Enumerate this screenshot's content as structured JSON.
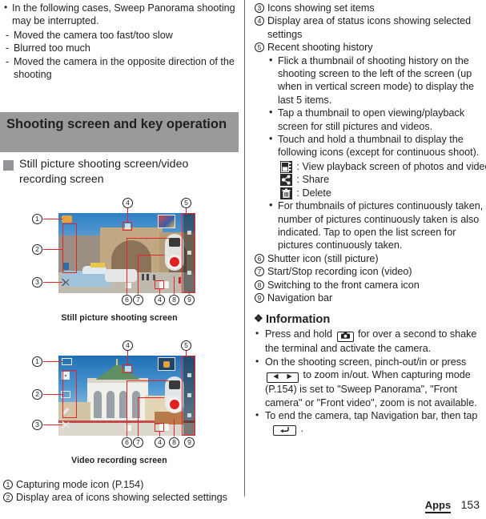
{
  "left": {
    "intro_bullet": "In the following cases, Sweep Panorama shooting may be interrupted.",
    "intro_subs": [
      "Moved the camera too fast/too slow",
      "Blurred too much",
      "Moved the camera in the opposite direction of the shooting"
    ],
    "section_heading": "Shooting screen and key operation",
    "subheading": "Still picture shooting screen/video recording screen",
    "figure1_caption": "Still picture shooting screen",
    "figure2_caption": "Video recording screen",
    "figure1_callouts": [
      "1",
      "2",
      "3",
      "4",
      "5",
      "6",
      "7",
      "4",
      "8",
      "9"
    ],
    "figure2_callouts": [
      "1",
      "2",
      "3",
      "4",
      "5",
      "6",
      "7",
      "4",
      "8",
      "9"
    ],
    "legend": [
      {
        "num": "1",
        "text": "Capturing mode icon (P.154)"
      },
      {
        "num": "2",
        "text": "Display area of icons showing selected settings"
      }
    ]
  },
  "right": {
    "items": [
      {
        "num": "3",
        "text": "Icons showing set items"
      },
      {
        "num": "4",
        "text": "Display area of status icons showing selected settings"
      },
      {
        "num": "5",
        "text": "Recent shooting history"
      }
    ],
    "history_bullets": [
      "Flick a thumbnail of shooting history on the shooting screen to the left of the screen (up when in vertical screen mode) to display the last 5 items.",
      "Tap a thumbnail to open viewing/playback screen for still pictures and videos.",
      "Touch and hold a thumbnail to display the following icons (except for continuous shoot).",
      "For thumbnails of pictures continuously taken, number of pictures continuously taken is also indicated. Tap to open the list screen for pictures continuously taken."
    ],
    "icon_legend": [
      {
        "icon": "gallery-icon",
        "label": ": View playback screen of photos and videos"
      },
      {
        "icon": "share-icon",
        "label": ": Share"
      },
      {
        "icon": "trash-icon",
        "label": ": Delete"
      }
    ],
    "items2": [
      {
        "num": "6",
        "text": "Shutter icon (still picture)"
      },
      {
        "num": "7",
        "text": "Start/Stop recording icon (video)"
      },
      {
        "num": "8",
        "text": "Switching to the front camera icon"
      },
      {
        "num": "9",
        "text": "Navigation bar"
      }
    ],
    "info_heading": "Information",
    "info_bullets": [
      {
        "pre": "Press and hold",
        "key": "camera-key-icon",
        "post": "for over a second to shake the terminal and activate the camera."
      },
      {
        "pre": "On the shooting screen, pinch-out/in or press",
        "key": "zoom-key-icon",
        "post": "to zoom in/out. When capturing mode (P.154) is set to \"Sweep Panorama\", \"Front camera\" or \"Front video\", zoom is not available."
      },
      {
        "pre": "To end the camera, tap Navigation bar, then tap",
        "key": "back-key-icon",
        "post": "."
      }
    ]
  },
  "footer": {
    "section_label": "Apps",
    "page_number": "153"
  },
  "colors": {
    "heading_bar": "#999a9a",
    "annotation_red": "#e3242b",
    "text": "#231f20"
  }
}
